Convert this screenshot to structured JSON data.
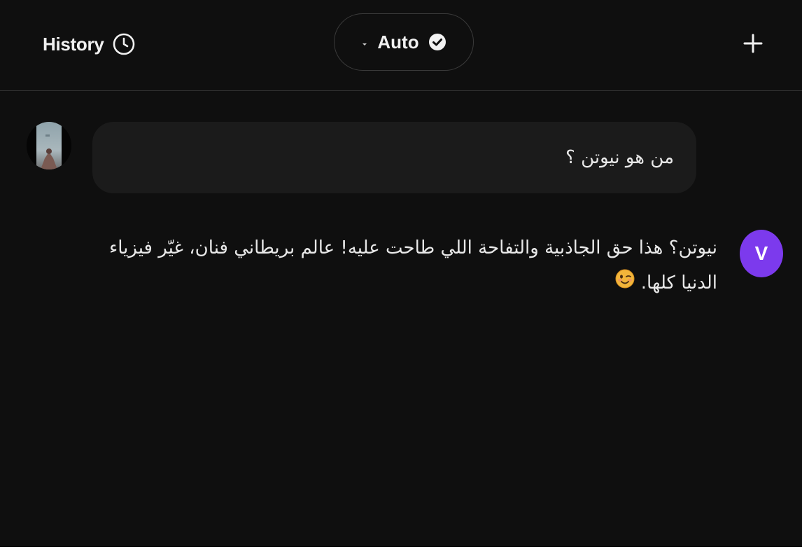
{
  "header": {
    "history_label": "History",
    "history_icon": "clock-icon",
    "model_label": "Auto",
    "model_dropdown_icon": "chevron-down-icon",
    "model_status_icon": "check-circle-icon",
    "new_chat_icon": "plus-icon"
  },
  "messages": [
    {
      "role": "user",
      "avatar_icon": "user-avatar-photo",
      "text": "من هو نيوتن ؟"
    },
    {
      "role": "assistant",
      "avatar_letter": "V",
      "avatar_color": "#7c3aed",
      "text": "نيوتن؟ هذا حق الجاذبية والتفاحة اللي طاحت عليه! عالم بريطاني فنان، غيّر فيزياء الدنيا كلها.",
      "emoji_icon": "winking-face-emoji"
    }
  ],
  "colors": {
    "background": "#0f0f0f",
    "bubble": "#1b1b1b",
    "accent": "#7c3aed",
    "text": "#ececec"
  }
}
